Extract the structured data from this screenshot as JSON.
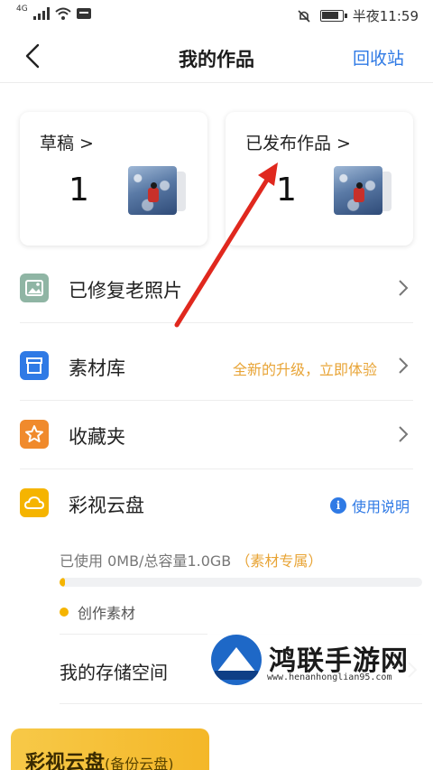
{
  "status_bar": {
    "network": "4G",
    "time": "半夜11:59",
    "battery_level": 0.85,
    "icons": [
      "signal-icon",
      "wifi-icon",
      "message-icon",
      "mute-icon",
      "battery-icon"
    ]
  },
  "nav": {
    "title": "我的作品",
    "back_icon": "chevron-left-icon",
    "recycle_label": "回收站"
  },
  "cards": {
    "draft": {
      "title": "草稿 >",
      "count": "1"
    },
    "published": {
      "title": "已发布作品 >",
      "count": "1"
    }
  },
  "rows": [
    {
      "label": "已修复老照片",
      "icon": "photo-icon",
      "icon_color": "#8fb5a4"
    },
    {
      "label": "素材库",
      "icon": "box-icon",
      "icon_color": "#2f7ae5",
      "extra": "全新的升级，立即体验"
    },
    {
      "label": "收藏夹",
      "icon": "star-icon",
      "icon_color": "#f08a2c"
    },
    {
      "label": "彩视云盘",
      "icon": "cloud-icon",
      "icon_color": "#f5b400",
      "help": "使用说明"
    }
  ],
  "cloud": {
    "usage_text": "已使用 0MB/总容量1.0GB",
    "usage_tag": "（素材专属）",
    "usage_fraction": 0.01,
    "legend_label": "创作素材",
    "storage_label": "我的存储空间"
  },
  "banner": {
    "title": "彩视云盘",
    "sub": "(备份云盘)"
  },
  "watermark": {
    "title": "鸿联手游网",
    "url": "www.henanhonglian95.com"
  },
  "colors": {
    "accent_blue": "#2f7ae5",
    "accent_orange": "#e8a436",
    "arrow_red": "#e0281e"
  }
}
